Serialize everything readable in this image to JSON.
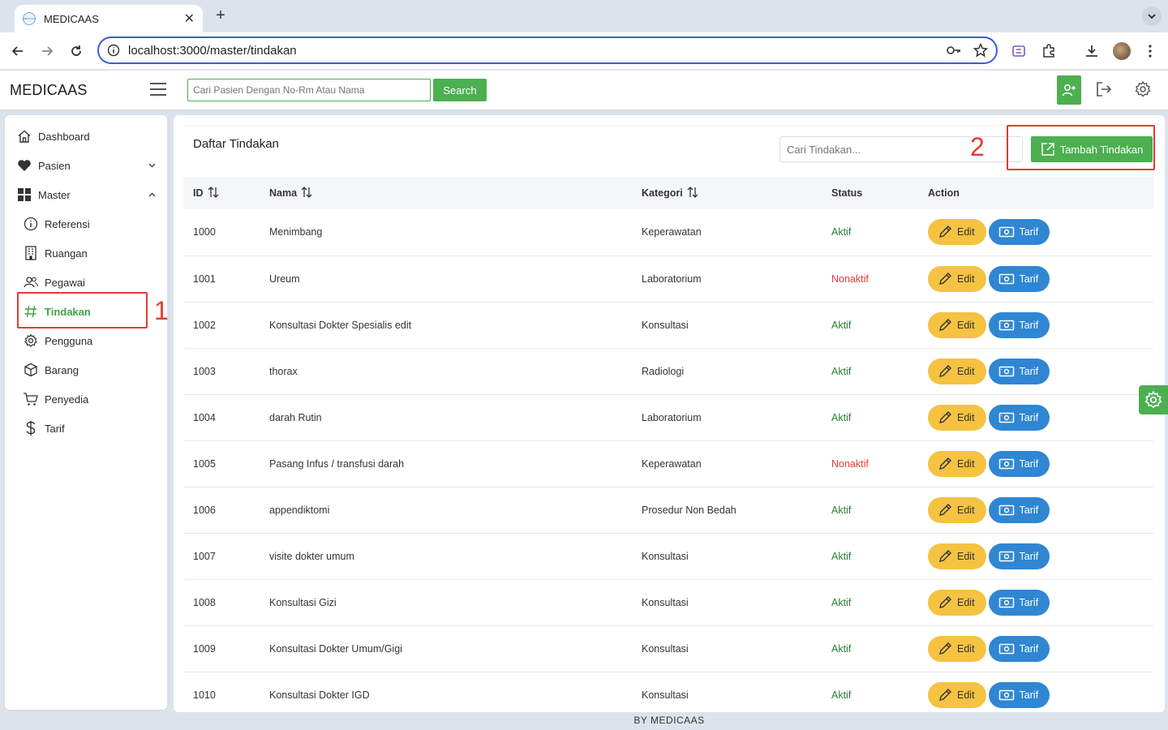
{
  "browser": {
    "tab_title": "MEDICAAS",
    "favicon_text": "MEDICAAS",
    "url": "localhost:3000/master/tindakan"
  },
  "header": {
    "brand": "MEDICAAS",
    "search_placeholder": "Cari Pasien Dengan No-Rm Atau Nama",
    "search_button": "Search"
  },
  "sidebar": {
    "items": [
      {
        "label": "Dashboard",
        "icon": "home-icon"
      },
      {
        "label": "Pasien",
        "icon": "heart-icon",
        "expandable": true
      },
      {
        "label": "Master",
        "icon": "grid-icon",
        "expanded": true
      }
    ],
    "master_subitems": [
      {
        "label": "Referensi",
        "icon": "info-icon"
      },
      {
        "label": "Ruangan",
        "icon": "building-icon"
      },
      {
        "label": "Pegawai",
        "icon": "users-icon"
      },
      {
        "label": "Tindakan",
        "icon": "hash-icon",
        "active": true
      },
      {
        "label": "Pengguna",
        "icon": "gear-icon"
      },
      {
        "label": "Barang",
        "icon": "box-icon"
      },
      {
        "label": "Penyedia",
        "icon": "cart-icon"
      },
      {
        "label": "Tarif",
        "icon": "dollar-icon"
      }
    ]
  },
  "annotations": {
    "marker_1": "1",
    "marker_2": "2"
  },
  "main": {
    "title": "Daftar Tindakan",
    "search_placeholder": "Cari Tindakan...",
    "add_button": "Tambah Tindakan",
    "columns": [
      "ID",
      "Nama",
      "Kategori",
      "Status",
      "Action"
    ],
    "edit_label": "Edit",
    "tarif_label": "Tarif",
    "rows": [
      {
        "id": "1000",
        "nama": "Menimbang",
        "kategori": "Keperawatan",
        "status": "Aktif"
      },
      {
        "id": "1001",
        "nama": "Ureum",
        "kategori": "Laboratorium",
        "status": "Nonaktif"
      },
      {
        "id": "1002",
        "nama": "Konsultasi Dokter Spesialis edit",
        "kategori": "Konsultasi",
        "status": "Aktif"
      },
      {
        "id": "1003",
        "nama": "thorax",
        "kategori": "Radiologi",
        "status": "Aktif"
      },
      {
        "id": "1004",
        "nama": "darah Rutin",
        "kategori": "Laboratorium",
        "status": "Aktif"
      },
      {
        "id": "1005",
        "nama": "Pasang Infus / transfusi darah",
        "kategori": "Keperawatan",
        "status": "Nonaktif"
      },
      {
        "id": "1006",
        "nama": "appendiktomi",
        "kategori": "Prosedur Non Bedah",
        "status": "Aktif"
      },
      {
        "id": "1007",
        "nama": "visite dokter umum",
        "kategori": "Konsultasi",
        "status": "Aktif"
      },
      {
        "id": "1008",
        "nama": "Konsultasi Gizi",
        "kategori": "Konsultasi",
        "status": "Aktif"
      },
      {
        "id": "1009",
        "nama": "Konsultasi Dokter Umum/Gigi",
        "kategori": "Konsultasi",
        "status": "Aktif"
      },
      {
        "id": "1010",
        "nama": "Konsultasi Dokter IGD",
        "kategori": "Konsultasi",
        "status": "Aktif"
      }
    ]
  },
  "footer": {
    "text": "BY  MEDICAAS"
  },
  "colors": {
    "accent_green": "#4caf50",
    "edit_yellow": "#f5c242",
    "tarif_blue": "#2f86d3",
    "status_active": "#2e7d32",
    "status_inactive": "#e53935",
    "annotation_red": "#e53935"
  }
}
